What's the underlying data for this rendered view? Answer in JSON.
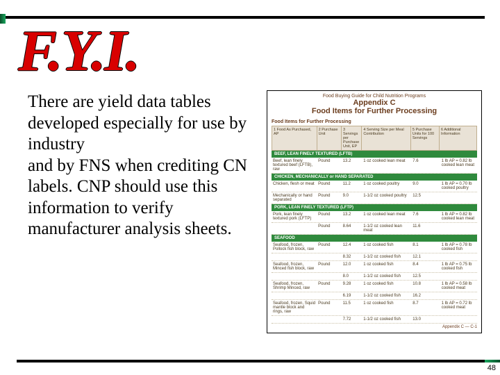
{
  "page_number": "48",
  "heading_fyi": "F.Y.I.",
  "body_text": "There are yield data tables developed especially for use by industry\nand by FNS when crediting CN labels. CNP should use this information to verify manufacturer analysis sheets.",
  "figure": {
    "pretitle": "Food Buying Guide for Child Nutrition Programs",
    "appendix": "Appendix C",
    "title": "Food Items for Further Processing",
    "subhead": "Food Items for Further Processing",
    "columns": [
      "1 Food As Purchased, AP",
      "2 Purchase Unit",
      "3 Servings per Purchase Unit, EP",
      "4 Serving Size per Meal Contribution",
      "5 Purchase Units for 100 Servings",
      "6 Additional Information"
    ],
    "sections": [
      {
        "title": "BEEF, LEAN FINELY TEXTURED (LFTB)",
        "rows": [
          {
            "c1": "Beef, lean finely textured beef (LFTB), raw",
            "c2": "Pound",
            "c3": "13.2",
            "c4": "1 oz cooked lean meat",
            "c5": "7.6",
            "c6": "1 lb AP = 0.82 lb cooked lean meat"
          }
        ]
      },
      {
        "title": "CHICKEN, MECHANICALLY or HAND SEPARATED",
        "rows": [
          {
            "c1": "Chicken, flesh or meat",
            "c2": "Pound",
            "c3": "11.2",
            "c4": "1 oz cooked poultry",
            "c5": "9.0",
            "c6": "1 lb AP = 0.70 lb cooked poultry"
          },
          {
            "c1": "Mechanically or hand separated",
            "c2": "Pound",
            "c3": "9.0",
            "c4": "1-1/2 oz cooked poultry",
            "c5": "12.5",
            "c6": ""
          }
        ]
      },
      {
        "title": "PORK, LEAN FINELY TEXTURED (LFTP)",
        "rows": [
          {
            "c1": "Pork, lean finely textured pork (LFTP)",
            "c2": "Pound",
            "c3": "13.2",
            "c4": "1 oz cooked lean meat",
            "c5": "7.6",
            "c6": "1 lb AP = 0.82 lb cooked lean meat"
          },
          {
            "c1": "",
            "c2": "Pound",
            "c3": "8.64",
            "c4": "1-1/2 oz cooked lean meat",
            "c5": "11.6",
            "c6": ""
          }
        ]
      },
      {
        "title": "SEAFOOD",
        "rows": [
          {
            "c1": "Seafood, frozen, Pollock fish block, raw",
            "c2": "Pound",
            "c3": "12.4",
            "c4": "1 oz cooked fish",
            "c5": "8.1",
            "c6": "1 lb AP = 0.78 lb cooked fish"
          },
          {
            "c1": "",
            "c2": "",
            "c3": "8.32",
            "c4": "1-1/2 oz cooked fish",
            "c5": "12.1",
            "c6": ""
          },
          {
            "c1": "Seafood, frozen, Minced fish block, raw",
            "c2": "Pound",
            "c3": "12.0",
            "c4": "1 oz cooked fish",
            "c5": "8.4",
            "c6": "1 lb AP = 0.75 lb cooked fish"
          },
          {
            "c1": "",
            "c2": "",
            "c3": "8.0",
            "c4": "1-1/2 oz cooked fish",
            "c5": "12.5",
            "c6": ""
          },
          {
            "c1": "Seafood, frozen, Shrimp Minced, raw",
            "c2": "Pound",
            "c3": "9.28",
            "c4": "1 oz cooked fish",
            "c5": "10.8",
            "c6": "1 lb AP = 0.58 lb cooked meat"
          },
          {
            "c1": "",
            "c2": "",
            "c3": "6.19",
            "c4": "1-1/2 oz cooked fish",
            "c5": "16.2",
            "c6": ""
          },
          {
            "c1": "Seafood, frozen, Squid mantle block and rings, raw",
            "c2": "Pound",
            "c3": "11.5",
            "c4": "1 oz cooked fish",
            "c5": "8.7",
            "c6": "1 lb AP = 0.72 lb cooked meat"
          },
          {
            "c1": "",
            "c2": "",
            "c3": "7.72",
            "c4": "1-1/2 oz cooked fish",
            "c5": "13.0",
            "c6": ""
          }
        ]
      }
    ],
    "footer": "Appendix C — C-1"
  }
}
